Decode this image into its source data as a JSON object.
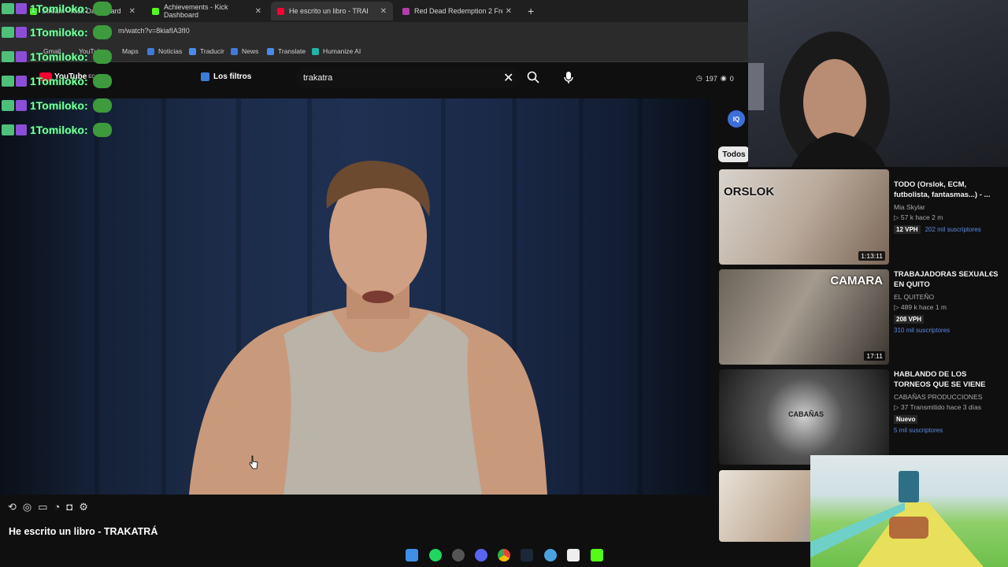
{
  "browser": {
    "tabs": [
      {
        "label": "Stream - Kick Dashboard",
        "color": "#53fc18"
      },
      {
        "label": "Achievements - Kick Dashboard",
        "color": "#53fc18"
      },
      {
        "label": "He escrito un libro - TRAKATRÁ",
        "color": "#ff0033"
      },
      {
        "label": "Red Dead Redemption 2 Free D",
        "color": "#b53ea8"
      }
    ],
    "url": "m/watch?v=8kiafIA3fI0",
    "bookmarks": [
      "Gmail",
      "YouTube",
      "Maps",
      "Noticias",
      "Traducir",
      "News",
      "Translate",
      "Humanize AI"
    ]
  },
  "youtube": {
    "logo": "YouTube",
    "logo_region": "EC",
    "filters_label": "Los filtros",
    "search_value": "trakatra",
    "stats_count": "197",
    "stats_views": "0",
    "video_title": "He escrito un libro - TRAKATRÁ",
    "todos_label": "Todos",
    "iq_label": "IQ"
  },
  "chat": {
    "username": "1Tomiloko:",
    "count_lines": 6
  },
  "recommendations": [
    {
      "title": "TODO (Orslok, ECM, futbolista, fantasmas...) - ...",
      "channel": "Mia Skylar",
      "views": "▷ 57 k  hace 2 m",
      "vph": "12 VPH",
      "subs": "202 mil suscriptores",
      "duration": "1:13:11",
      "thumb_text": "ORSLOK"
    },
    {
      "title": "TRABAJADORAS SEXUAL€S EN QUITO",
      "channel": "EL QUITEÑO",
      "views": "▷ 489 k  hace 1 m",
      "vph": "208 VPH",
      "subs": "310 mil suscriptores",
      "duration": "17:11",
      "thumb_text": "CAMARA"
    },
    {
      "title": "HABLANDO DE LOS TORNEOS QUE SE VIENE",
      "channel": "CABAÑAS PRODUCCIONES",
      "views": "▷ 37  Transmitido hace 3 días",
      "vph": "Nuevo",
      "subs": "5 mil suscriptores",
      "duration": "",
      "thumb_text": "CABAÑAS"
    }
  ],
  "colors": {
    "background": "#0f0f0f",
    "chat_name": "#7dff9c",
    "subs_link": "#5b8ae0"
  }
}
